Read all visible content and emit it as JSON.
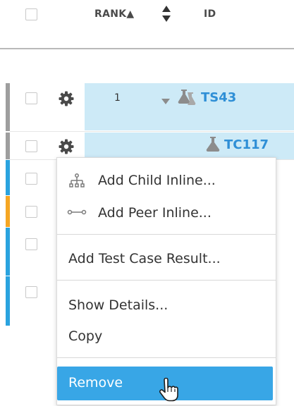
{
  "header": {
    "rank_label": "RANK▲",
    "id_label": "ID"
  },
  "rows": [
    {
      "rank": "1",
      "id": "TS43",
      "strip_color": "#9e9e9e",
      "highlighted": true
    },
    {
      "rank": "",
      "id": "TC117",
      "strip_color": "#9e9e9e",
      "highlighted": true
    },
    {
      "strip_color": "#2aa3df"
    },
    {
      "strip_color": "#f5a623"
    },
    {
      "strip_color": "#2aa3df"
    },
    {
      "strip_color": "#2aa3df"
    }
  ],
  "context_menu": {
    "items": [
      {
        "label": "Add Child Inline...",
        "icon": "hierarchy-icon"
      },
      {
        "label": "Add Peer Inline...",
        "icon": "link-icon"
      },
      {
        "label": "Add Test Case Result..."
      },
      {
        "label": "Show Details..."
      },
      {
        "label": "Copy"
      },
      {
        "label": "Remove",
        "active": true
      }
    ]
  },
  "colors": {
    "accent": "#38a6e6",
    "highlight_row": "#cdeaf7",
    "link": "#2f8fd6"
  }
}
